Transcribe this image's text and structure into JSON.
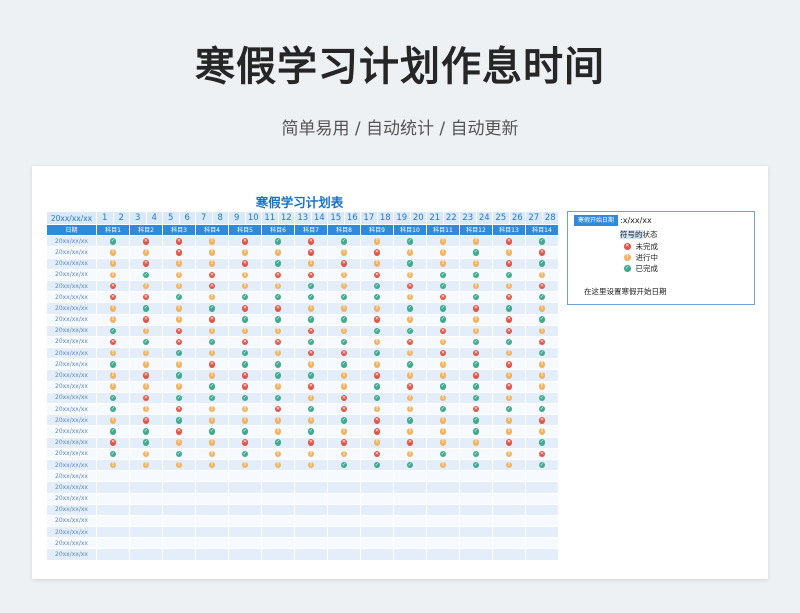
{
  "page": {
    "title": "寒假学习计划作息时间",
    "subtitle": "简单易用 / 自动统计 / 自动更新"
  },
  "sheet": {
    "title": "寒假学习计划表",
    "date_header": "20xx/xx/xx",
    "row_header": "日期",
    "days": [
      "1",
      "2",
      "3",
      "4",
      "5",
      "6",
      "7",
      "8",
      "9",
      "10",
      "11",
      "12",
      "13",
      "14",
      "15",
      "16",
      "17",
      "18",
      "19",
      "20",
      "21",
      "22",
      "23",
      "24",
      "25",
      "26",
      "27",
      "28"
    ],
    "subjects": [
      "科目1",
      "科目2",
      "科目3",
      "科目4",
      "科目5",
      "科目6",
      "科目7",
      "科目8",
      "科目9",
      "科目10",
      "科目11",
      "科目12",
      "科目13",
      "科目14"
    ],
    "row_date": "20xx/xx/xx",
    "status_legend": {
      "0": "未完成",
      "1": "进行中",
      "2": "已完成"
    },
    "status_colors": {
      "0": "#e05545",
      "1": "#f2b360",
      "2": "#3faa8f"
    },
    "status_icons": {
      "0": "cross-circle-icon",
      "1": "exclamation-circle-icon",
      "2": "check-circle-icon"
    },
    "rows": [
      [
        2,
        0,
        0,
        1,
        0,
        2,
        0,
        2,
        1,
        2,
        1,
        1,
        0,
        2
      ],
      [
        1,
        1,
        0,
        1,
        1,
        1,
        0,
        1,
        0,
        1,
        1,
        2,
        1,
        0
      ],
      [
        1,
        0,
        1,
        1,
        0,
        2,
        1,
        0,
        1,
        2,
        1,
        1,
        0,
        2
      ],
      [
        1,
        2,
        1,
        0,
        1,
        0,
        0,
        1,
        0,
        1,
        2,
        2,
        2,
        1
      ],
      [
        0,
        1,
        1,
        0,
        1,
        1,
        2,
        1,
        2,
        0,
        2,
        1,
        1,
        0
      ],
      [
        0,
        0,
        2,
        1,
        2,
        2,
        2,
        2,
        2,
        1,
        0,
        2,
        0,
        2
      ],
      [
        1,
        2,
        1,
        2,
        0,
        0,
        1,
        1,
        1,
        2,
        2,
        0,
        2,
        1
      ],
      [
        1,
        0,
        1,
        0,
        2,
        2,
        2,
        2,
        0,
        1,
        2,
        1,
        0,
        2
      ],
      [
        2,
        1,
        0,
        1,
        1,
        1,
        0,
        1,
        2,
        2,
        0,
        1,
        0,
        1
      ],
      [
        0,
        2,
        0,
        2,
        0,
        0,
        2,
        2,
        1,
        0,
        1,
        2,
        2,
        0
      ],
      [
        1,
        1,
        2,
        1,
        2,
        1,
        0,
        0,
        2,
        1,
        0,
        0,
        1,
        2
      ],
      [
        2,
        1,
        1,
        0,
        2,
        2,
        1,
        2,
        1,
        2,
        1,
        2,
        0,
        1
      ],
      [
        1,
        0,
        2,
        1,
        0,
        2,
        2,
        1,
        0,
        1,
        1,
        0,
        1,
        1
      ],
      [
        1,
        1,
        1,
        2,
        0,
        1,
        0,
        1,
        2,
        0,
        2,
        2,
        0,
        1
      ],
      [
        2,
        0,
        2,
        2,
        2,
        2,
        1,
        0,
        2,
        1,
        1,
        2,
        1,
        2
      ],
      [
        2,
        1,
        0,
        1,
        1,
        0,
        2,
        0,
        1,
        1,
        2,
        0,
        2,
        2
      ],
      [
        1,
        0,
        2,
        1,
        1,
        1,
        1,
        2,
        0,
        2,
        1,
        2,
        1,
        0
      ],
      [
        2,
        2,
        0,
        2,
        2,
        1,
        2,
        1,
        0,
        1,
        1,
        2,
        1,
        1
      ],
      [
        0,
        2,
        1,
        1,
        0,
        2,
        0,
        0,
        1,
        0,
        1,
        1,
        0,
        2
      ],
      [
        2,
        1,
        2,
        1,
        2,
        1,
        1,
        1,
        0,
        1,
        2,
        2,
        1,
        0
      ],
      [
        1,
        1,
        1,
        1,
        1,
        1,
        1,
        2,
        2,
        2,
        1,
        2,
        1,
        2
      ],
      [],
      [],
      [],
      [],
      [],
      [],
      [],
      []
    ]
  },
  "panel": {
    "start_label": "寒假开始日期",
    "start_value": ":x/xx/xx",
    "legend_title_highlight": "符号的",
    "legend_title_rest": "状态",
    "note": "在这里设置寒假开始日期"
  }
}
